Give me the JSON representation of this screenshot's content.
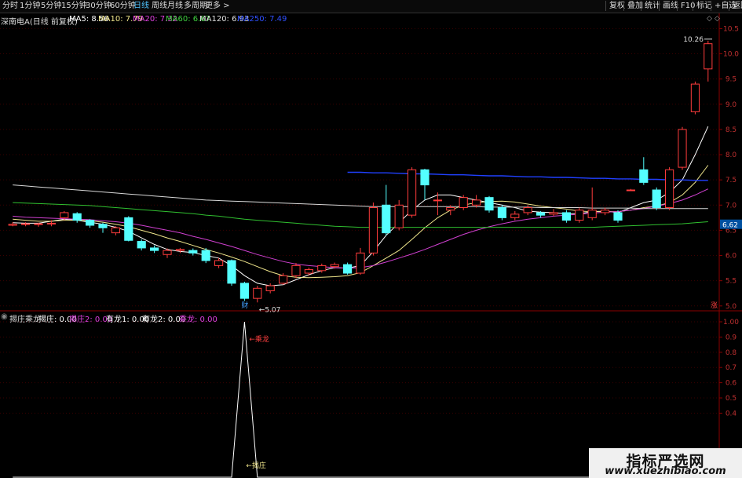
{
  "toolbar": {
    "tabs": [
      "分时",
      "1分钟",
      "5分钟",
      "15分钟",
      "30分钟",
      "60分钟",
      "日线",
      "周线",
      "月线",
      "多周期",
      "更多 >"
    ],
    "active_tab": "日线",
    "right_buttons": [
      "复权",
      "叠加",
      "统计",
      "画线",
      "F10",
      "标记",
      "+自选",
      "返回"
    ]
  },
  "main_chart": {
    "stock_label": "深南电A(日线 前复权)",
    "ma": [
      {
        "label": "MA5: 8.56",
        "color": "#ffffff"
      },
      {
        "label": "MA10: 7.79",
        "color": "#f0e68c"
      },
      {
        "label": "MA20: 7.32",
        "color": "#e040e0"
      },
      {
        "label": "MA60: 6.67",
        "color": "#40d040"
      },
      {
        "label": "MA120: 6.93",
        "color": "#e0e0e0"
      },
      {
        "label": "MA250: 7.49",
        "color": "#3050ff"
      }
    ],
    "price_axis": [
      "10.5",
      "10.0",
      "9.5",
      "9.0",
      "8.5",
      "8.0",
      "7.5",
      "7.0",
      "6.5",
      "6.0",
      "5.5",
      "5.0"
    ],
    "current_price": "6.62",
    "high_label": "10.26",
    "low_label": "5.07",
    "cai_marker": "财",
    "zhang_marker": "涨"
  },
  "indicator": {
    "title": "揭庄乘龙",
    "values": [
      {
        "label": "揭庄: 0.00",
        "color": "#ffffff"
      },
      {
        "label": "揭庄2: 0.00",
        "color": "#e040e0"
      },
      {
        "label": "有龙1: 0.00",
        "color": "#ffffff"
      },
      {
        "label": "有龙2: 0.00",
        "color": "#ffffff"
      },
      {
        "label": "乘龙: 0.00",
        "color": "#e040e0"
      }
    ],
    "axis": [
      "1.00",
      "0.9",
      "0.8",
      "0.7",
      "0.6",
      "0.5",
      "0.4"
    ],
    "annotation_top": "←乘龙",
    "annotation_bottom": "←揭庄"
  },
  "chart_data": {
    "type": "candlestick",
    "ylim": [
      4.95,
      10.6
    ],
    "candles": [
      {
        "o": 6.6,
        "c": 6.62,
        "h": 6.66,
        "l": 6.58
      },
      {
        "o": 6.62,
        "c": 6.63,
        "h": 6.66,
        "l": 6.58
      },
      {
        "o": 6.62,
        "c": 6.63,
        "h": 6.65,
        "l": 6.57
      },
      {
        "o": 6.63,
        "c": 6.64,
        "h": 6.7,
        "l": 6.58
      },
      {
        "o": 6.75,
        "c": 6.85,
        "h": 6.88,
        "l": 6.7
      },
      {
        "o": 6.83,
        "c": 6.7,
        "h": 6.86,
        "l": 6.65
      },
      {
        "o": 6.7,
        "c": 6.6,
        "h": 6.72,
        "l": 6.55
      },
      {
        "o": 6.62,
        "c": 6.55,
        "h": 6.65,
        "l": 6.45
      },
      {
        "o": 6.45,
        "c": 6.55,
        "h": 6.58,
        "l": 6.4
      },
      {
        "o": 6.75,
        "c": 6.3,
        "h": 6.78,
        "l": 6.28
      },
      {
        "o": 6.28,
        "c": 6.15,
        "h": 6.32,
        "l": 6.1
      },
      {
        "o": 6.15,
        "c": 6.1,
        "h": 6.2,
        "l": 6.05
      },
      {
        "o": 6.02,
        "c": 6.1,
        "h": 6.14,
        "l": 5.95
      },
      {
        "o": 6.1,
        "c": 6.12,
        "h": 6.15,
        "l": 6.05
      },
      {
        "o": 6.1,
        "c": 6.05,
        "h": 6.14,
        "l": 6.0
      },
      {
        "o": 6.1,
        "c": 5.9,
        "h": 6.15,
        "l": 5.85
      },
      {
        "o": 5.8,
        "c": 5.9,
        "h": 5.95,
        "l": 5.75
      },
      {
        "o": 5.9,
        "c": 5.45,
        "h": 5.92,
        "l": 5.4
      },
      {
        "o": 5.45,
        "c": 5.15,
        "h": 5.48,
        "l": 5.1
      },
      {
        "o": 5.15,
        "c": 5.35,
        "h": 5.4,
        "l": 5.07
      },
      {
        "o": 5.3,
        "c": 5.4,
        "h": 5.45,
        "l": 5.25
      },
      {
        "o": 5.45,
        "c": 5.6,
        "h": 5.65,
        "l": 5.42
      },
      {
        "o": 5.6,
        "c": 5.8,
        "h": 5.85,
        "l": 5.55
      },
      {
        "o": 5.65,
        "c": 5.72,
        "h": 5.76,
        "l": 5.6
      },
      {
        "o": 5.7,
        "c": 5.8,
        "h": 5.84,
        "l": 5.66
      },
      {
        "o": 5.78,
        "c": 5.82,
        "h": 5.86,
        "l": 5.74
      },
      {
        "o": 5.82,
        "c": 5.65,
        "h": 5.86,
        "l": 5.62
      },
      {
        "o": 5.65,
        "c": 6.05,
        "h": 6.15,
        "l": 5.62
      },
      {
        "o": 6.05,
        "c": 6.95,
        "h": 7.05,
        "l": 6.0
      },
      {
        "o": 7.0,
        "c": 6.45,
        "h": 7.4,
        "l": 6.4
      },
      {
        "o": 6.55,
        "c": 7.0,
        "h": 7.1,
        "l": 6.5
      },
      {
        "o": 6.8,
        "c": 7.7,
        "h": 7.75,
        "l": 6.75
      },
      {
        "o": 7.7,
        "c": 7.4,
        "h": 7.72,
        "l": 7.1
      },
      {
        "o": 7.1,
        "c": 7.1,
        "h": 7.25,
        "l": 6.8
      },
      {
        "o": 6.9,
        "c": 6.95,
        "h": 7.0,
        "l": 6.8
      },
      {
        "o": 6.95,
        "c": 7.15,
        "h": 7.2,
        "l": 6.9
      },
      {
        "o": 7.0,
        "c": 7.1,
        "h": 7.2,
        "l": 6.95
      },
      {
        "o": 7.15,
        "c": 6.9,
        "h": 7.18,
        "l": 6.85
      },
      {
        "o": 6.95,
        "c": 6.75,
        "h": 7.0,
        "l": 6.7
      },
      {
        "o": 6.75,
        "c": 6.82,
        "h": 6.88,
        "l": 6.7
      },
      {
        "o": 6.85,
        "c": 6.95,
        "h": 7.0,
        "l": 6.8
      },
      {
        "o": 6.85,
        "c": 6.8,
        "h": 6.88,
        "l": 6.75
      },
      {
        "o": 6.82,
        "c": 6.85,
        "h": 6.92,
        "l": 6.78
      },
      {
        "o": 6.85,
        "c": 6.7,
        "h": 6.9,
        "l": 6.65
      },
      {
        "o": 6.7,
        "c": 6.9,
        "h": 6.95,
        "l": 6.65
      },
      {
        "o": 6.75,
        "c": 6.9,
        "h": 7.35,
        "l": 6.7
      },
      {
        "o": 6.85,
        "c": 6.9,
        "h": 6.95,
        "l": 6.8
      },
      {
        "o": 6.85,
        "c": 6.7,
        "h": 6.9,
        "l": 6.65
      },
      {
        "o": 7.3,
        "c": 7.3,
        "h": 7.32,
        "l": 7.28
      },
      {
        "o": 7.7,
        "c": 7.45,
        "h": 7.95,
        "l": 7.4
      },
      {
        "o": 7.3,
        "c": 6.95,
        "h": 7.35,
        "l": 6.9
      },
      {
        "o": 6.95,
        "c": 7.7,
        "h": 7.75,
        "l": 6.9
      },
      {
        "o": 7.75,
        "c": 8.5,
        "h": 8.55,
        "l": 7.7
      },
      {
        "o": 8.85,
        "c": 9.4,
        "h": 9.45,
        "l": 8.8
      },
      {
        "o": 9.7,
        "c": 10.2,
        "h": 10.26,
        "l": 9.45
      }
    ],
    "ma_lines": {
      "MA5": [
        6.65,
        6.64,
        6.64,
        6.68,
        6.72,
        6.7,
        6.66,
        6.62,
        6.56,
        6.48,
        6.35,
        6.22,
        6.12,
        6.08,
        6.06,
        6.0,
        5.95,
        5.8,
        5.6,
        5.45,
        5.4,
        5.42,
        5.52,
        5.62,
        5.7,
        5.76,
        5.75,
        5.8,
        6.08,
        6.4,
        6.65,
        6.9,
        7.1,
        7.2,
        7.2,
        7.15,
        7.1,
        7.05,
        7.0,
        6.95,
        6.88,
        6.86,
        6.85,
        6.83,
        6.83,
        6.87,
        6.88,
        6.85,
        6.95,
        7.05,
        7.1,
        7.25,
        7.5,
        8.0,
        8.56
      ],
      "MA10": [
        6.72,
        6.7,
        6.68,
        6.68,
        6.7,
        6.7,
        6.69,
        6.66,
        6.62,
        6.57,
        6.5,
        6.43,
        6.35,
        6.28,
        6.2,
        6.12,
        6.05,
        5.97,
        5.88,
        5.78,
        5.68,
        5.6,
        5.57,
        5.56,
        5.57,
        5.58,
        5.6,
        5.66,
        5.8,
        5.95,
        6.1,
        6.32,
        6.55,
        6.75,
        6.9,
        7.0,
        7.05,
        7.07,
        7.08,
        7.06,
        7.02,
        6.98,
        6.95,
        6.92,
        6.88,
        6.87,
        6.87,
        6.87,
        6.9,
        6.95,
        6.98,
        7.05,
        7.2,
        7.45,
        7.79
      ],
      "MA20": [
        6.78,
        6.76,
        6.75,
        6.74,
        6.73,
        6.72,
        6.71,
        6.69,
        6.67,
        6.64,
        6.6,
        6.55,
        6.5,
        6.45,
        6.38,
        6.32,
        6.25,
        6.18,
        6.1,
        6.02,
        5.95,
        5.88,
        5.83,
        5.8,
        5.78,
        5.76,
        5.75,
        5.76,
        5.8,
        5.87,
        5.95,
        6.03,
        6.12,
        6.22,
        6.32,
        6.42,
        6.5,
        6.57,
        6.63,
        6.68,
        6.72,
        6.75,
        6.78,
        6.8,
        6.82,
        6.84,
        6.86,
        6.87,
        6.9,
        6.93,
        6.98,
        7.03,
        7.1,
        7.2,
        7.32
      ],
      "MA60": [
        7.05,
        7.04,
        7.03,
        7.02,
        7.01,
        7.0,
        6.99,
        6.97,
        6.95,
        6.93,
        6.91,
        6.89,
        6.87,
        6.85,
        6.83,
        6.8,
        6.78,
        6.75,
        6.72,
        6.7,
        6.68,
        6.66,
        6.64,
        6.62,
        6.6,
        6.58,
        6.57,
        6.56,
        6.56,
        6.56,
        6.56,
        6.56,
        6.56,
        6.56,
        6.56,
        6.56,
        6.56,
        6.56,
        6.56,
        6.56,
        6.56,
        6.56,
        6.56,
        6.56,
        6.56,
        6.56,
        6.57,
        6.58,
        6.59,
        6.6,
        6.61,
        6.62,
        6.63,
        6.65,
        6.67
      ],
      "MA120": [
        7.4,
        7.38,
        7.36,
        7.34,
        7.32,
        7.3,
        7.28,
        7.26,
        7.24,
        7.22,
        7.2,
        7.18,
        7.16,
        7.14,
        7.12,
        7.1,
        7.09,
        7.08,
        7.07,
        7.06,
        7.05,
        7.04,
        7.03,
        7.02,
        7.01,
        7.0,
        6.99,
        6.98,
        6.97,
        6.97,
        6.97,
        6.97,
        6.97,
        6.97,
        6.97,
        6.97,
        6.97,
        6.96,
        6.96,
        6.96,
        6.96,
        6.95,
        6.95,
        6.95,
        6.95,
        6.94,
        6.94,
        6.94,
        6.94,
        6.93,
        6.93,
        6.93,
        6.93,
        6.93,
        6.93
      ],
      "MA250": [
        null,
        null,
        null,
        null,
        null,
        null,
        null,
        null,
        null,
        null,
        null,
        null,
        null,
        null,
        null,
        null,
        null,
        null,
        null,
        null,
        null,
        null,
        null,
        null,
        null,
        null,
        7.65,
        7.65,
        7.64,
        7.64,
        7.63,
        7.62,
        7.62,
        7.61,
        7.6,
        7.6,
        7.59,
        7.58,
        7.58,
        7.57,
        7.56,
        7.56,
        7.55,
        7.55,
        7.54,
        7.53,
        7.53,
        7.52,
        7.52,
        7.51,
        7.51,
        7.5,
        7.5,
        7.49,
        7.49
      ]
    },
    "indicator_series": [
      0,
      0,
      0,
      0,
      0,
      0,
      0,
      0,
      0,
      0,
      0,
      0,
      0,
      0,
      0,
      0,
      0,
      0,
      1,
      0,
      0,
      0,
      0,
      0,
      0,
      0,
      0,
      0,
      0,
      0,
      0,
      0,
      0,
      0,
      0,
      0,
      0,
      0,
      0,
      0,
      0,
      0,
      0,
      0,
      0,
      0,
      0,
      0,
      0,
      0,
      0,
      0,
      0,
      0,
      0
    ],
    "indicator_ylim": [
      0,
      1.0
    ]
  },
  "watermark": {
    "title": "指标严选网",
    "url": "www.xuezhibiao.com"
  }
}
